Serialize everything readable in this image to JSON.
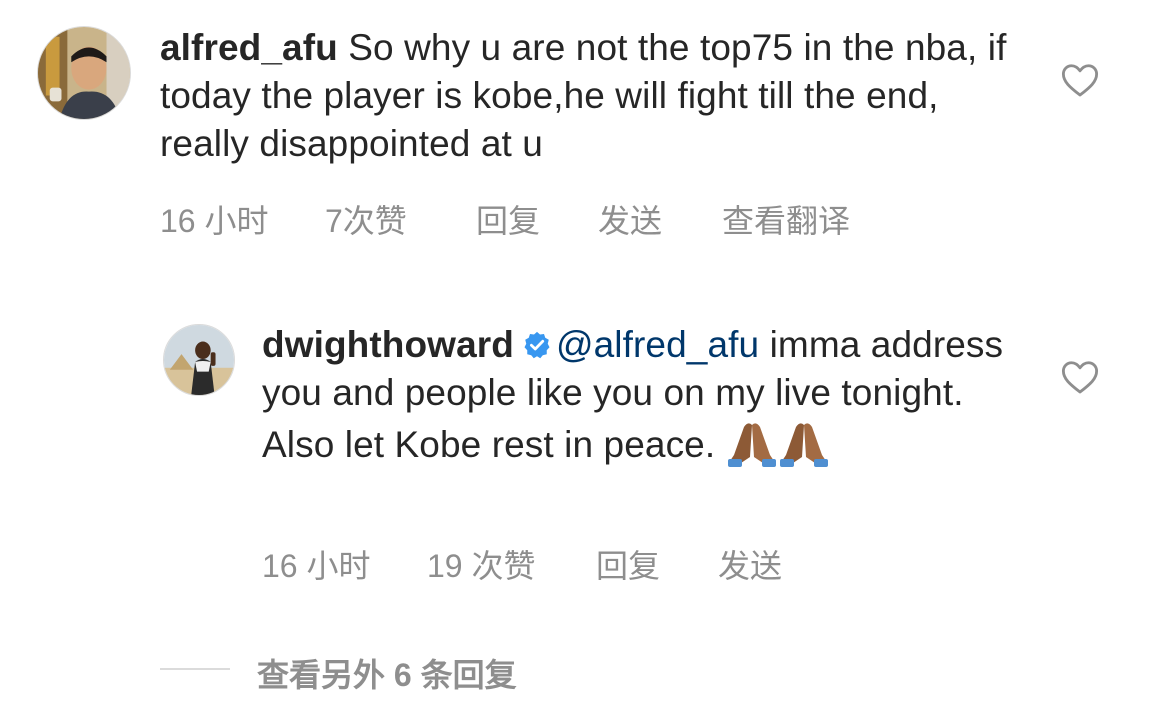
{
  "comments": [
    {
      "username": "alfred_afu",
      "text": "So why u are not the top75 in the nba, if today the player is kobe,he will fight till the end, really disappointed at u",
      "time": "16 小时",
      "likes": "7次赞",
      "reply_label": "回复",
      "send_label": "发送",
      "translate_label": "查看翻译",
      "avatar_icon": "profile-photo",
      "like_icon": "heart-outline-icon"
    },
    {
      "username": "dwighthoward",
      "verified": true,
      "verified_icon": "verified-badge-icon",
      "mention": "@alfred_afu",
      "text": "imma address you and people like you on my live tonight.  Also let Kobe rest in peace.",
      "emoji": "folded-hands-emoji x2",
      "time": "16 小时",
      "likes": "19 次赞",
      "reply_label": "回复",
      "send_label": "发送",
      "avatar_icon": "profile-photo",
      "like_icon": "heart-outline-icon"
    }
  ],
  "view_more_replies": "查看另外 6 条回复",
  "colors": {
    "text": "#262626",
    "secondary": "#8e8e8e",
    "mention": "#00376b",
    "verified": "#3897f0"
  }
}
